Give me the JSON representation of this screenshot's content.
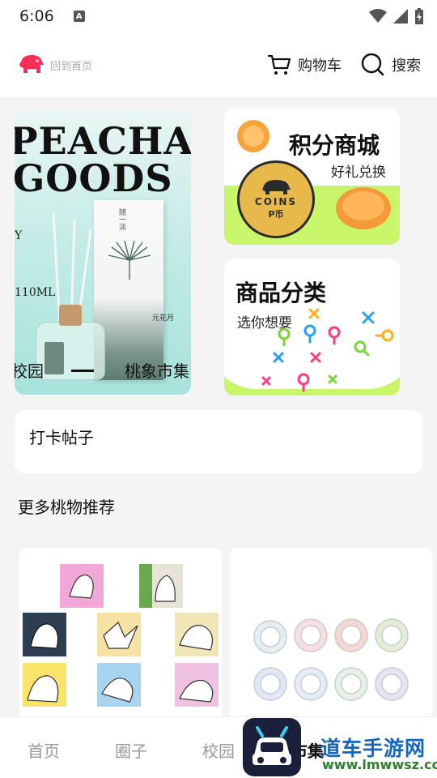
{
  "status_bar": {
    "time": "6:06",
    "notif_letter": "A"
  },
  "header": {
    "logo_text": "回到首页",
    "cart_label": "购物车",
    "search_label": "搜索",
    "brand_color": "#ff2d55"
  },
  "banner": {
    "line1": "PEACHANT",
    "line2": "GOODS",
    "y_label": "Y",
    "volume": "110ML",
    "box_text_top": "随一淡",
    "box_text_side": "元花月",
    "caption_left": "校园",
    "caption_right": "桃象市集"
  },
  "promos": [
    {
      "title": "积分商城",
      "subtitle": "好礼兑换",
      "coin_text": "COINS",
      "coin_sub": "P币",
      "bg_accent": "#c9f56a"
    },
    {
      "title": "商品分类",
      "subtitle": "选你想要",
      "bg_accent": "#c9f56a"
    }
  ],
  "checkin": {
    "label": "打卡帖子"
  },
  "recommend": {
    "title": "更多桃物推荐"
  },
  "tabbar": {
    "tabs": [
      {
        "label": "首页",
        "active": false
      },
      {
        "label": "圈子",
        "active": false
      },
      {
        "label": "校园",
        "active": false
      },
      {
        "label": "市集",
        "active": true
      }
    ]
  },
  "watermark": {
    "title": "道车手游网",
    "url": "www.lmwwsz.com"
  }
}
